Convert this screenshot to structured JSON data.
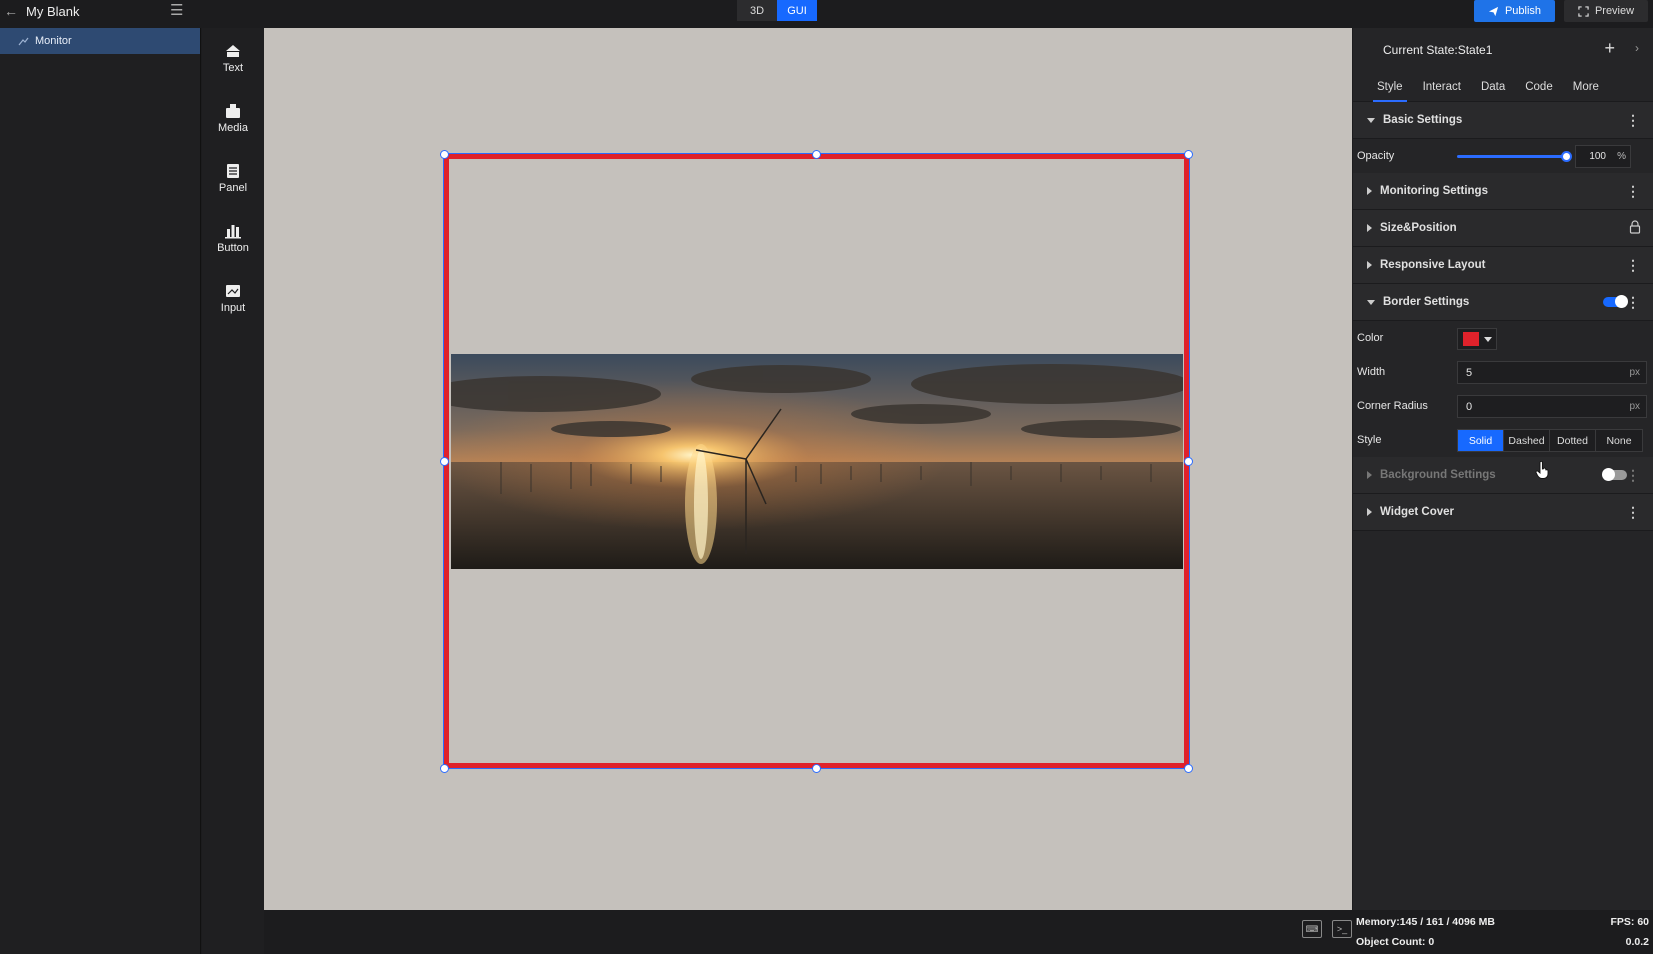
{
  "project": {
    "name": "My Blank"
  },
  "mode_switch": {
    "options": [
      "3D",
      "GUI"
    ],
    "active": "GUI"
  },
  "actions": {
    "publish": "Publish",
    "preview": "Preview"
  },
  "tree": {
    "items": [
      {
        "label": "Monitor"
      }
    ]
  },
  "widgets": [
    {
      "label": "Text",
      "icon": "text-widget-icon"
    },
    {
      "label": "Media",
      "icon": "media-widget-icon"
    },
    {
      "label": "Panel",
      "icon": "panel-widget-icon"
    },
    {
      "label": "Button",
      "icon": "button-widget-icon"
    },
    {
      "label": "Input",
      "icon": "input-widget-icon"
    }
  ],
  "panel": {
    "state": "Current State:State1",
    "tabs": [
      "Style",
      "Interact",
      "Data",
      "Code",
      "More"
    ],
    "active_tab": "Style",
    "sections": {
      "basic": "Basic Settings",
      "monitoring": "Monitoring Settings",
      "size_position": "Size&Position",
      "responsive": "Responsive Layout",
      "border": "Border Settings",
      "background": "Background Settings",
      "cover": "Widget Cover"
    },
    "opacity": {
      "label": "Opacity",
      "value": "100",
      "unit": "%",
      "level": 1.0
    },
    "border": {
      "toggle_on": true,
      "color_label": "Color",
      "color": "#e0222b",
      "width_label": "Width",
      "width_value": "5",
      "width_unit": "px",
      "radius_label": "Corner Radius",
      "radius_value": "0",
      "radius_unit": "px",
      "style_label": "Style",
      "style_options": [
        "Solid",
        "Dashed",
        "Dotted",
        "None"
      ],
      "style_active": "Solid"
    },
    "background_toggle_on": false
  },
  "stats": {
    "memory": "Memory:145 / 161 / 4096 MB",
    "fps": "FPS: 60",
    "object_count": "Object Count: 0",
    "version": "0.0.2"
  },
  "colors": {
    "accent": "#1769ff",
    "border": "#e0222b",
    "canvas": "#c5c1bc"
  }
}
